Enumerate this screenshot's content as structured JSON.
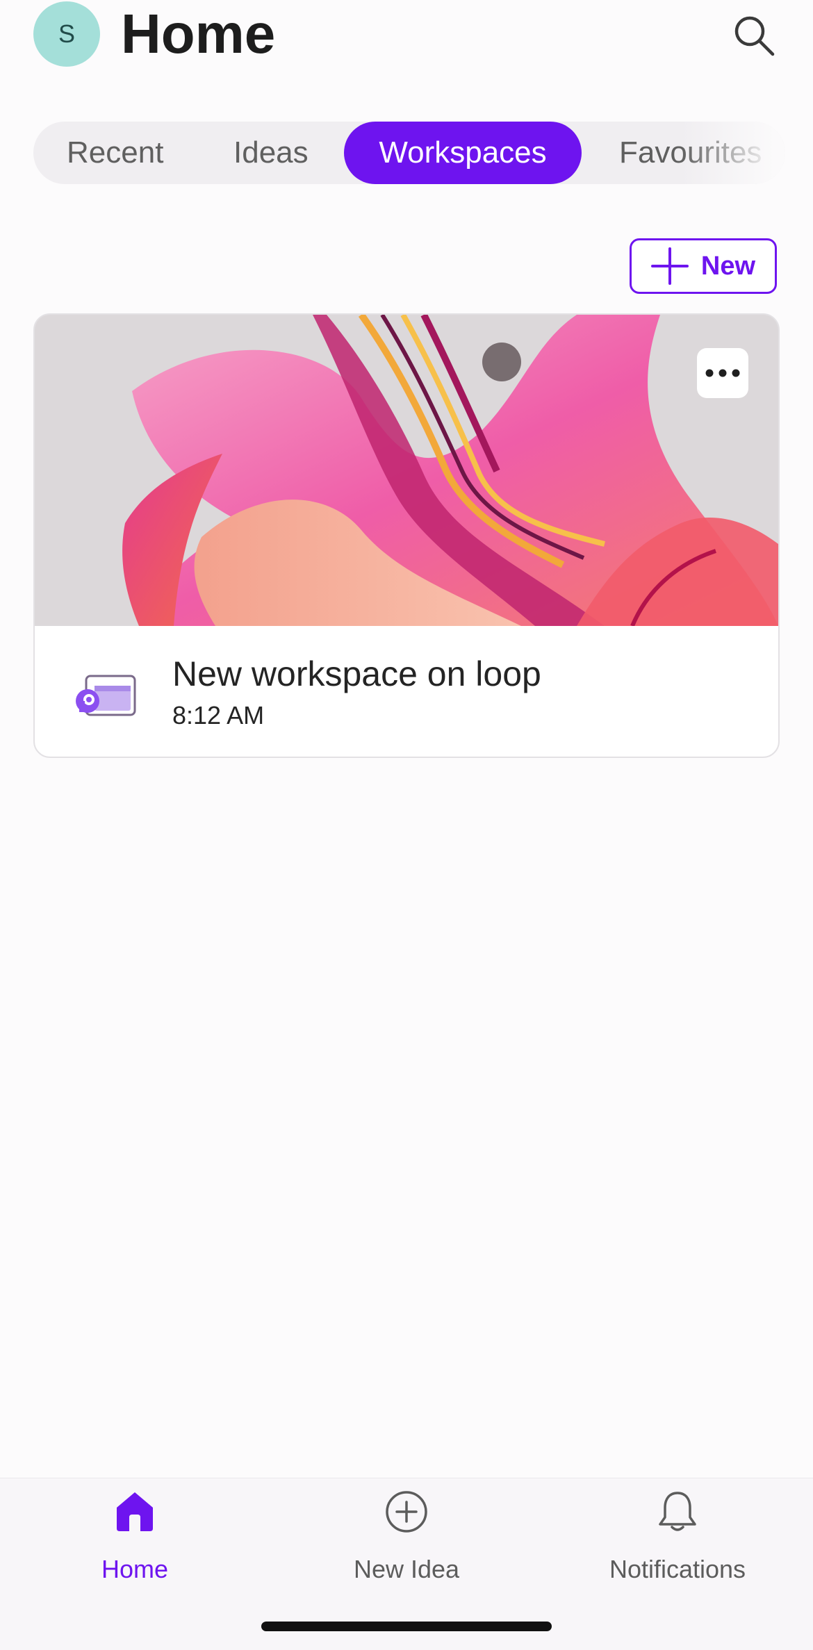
{
  "header": {
    "avatar_initial": "S",
    "title": "Home",
    "search_icon": "search-icon"
  },
  "tabs": [
    {
      "label": "Recent",
      "active": false
    },
    {
      "label": "Ideas",
      "active": false
    },
    {
      "label": "Workspaces",
      "active": true
    },
    {
      "label": "Favourites",
      "active": false
    }
  ],
  "toolbar": {
    "new_label": "New",
    "new_icon": "plus-icon"
  },
  "workspace_card": {
    "title": "New workspace on loop",
    "time": "8:12 AM",
    "icon": "loop-workspace-icon",
    "more_icon": "more-horizontal-icon"
  },
  "bottom_nav": [
    {
      "label": "Home",
      "icon": "home-icon",
      "active": true
    },
    {
      "label": "New Idea",
      "icon": "add-circle-icon",
      "active": false
    },
    {
      "label": "Notifications",
      "icon": "bell-icon",
      "active": false
    }
  ],
  "colors": {
    "accent": "#6e14ef",
    "avatar_bg": "#a4dfd9",
    "tab_track": "#f0eef1"
  }
}
